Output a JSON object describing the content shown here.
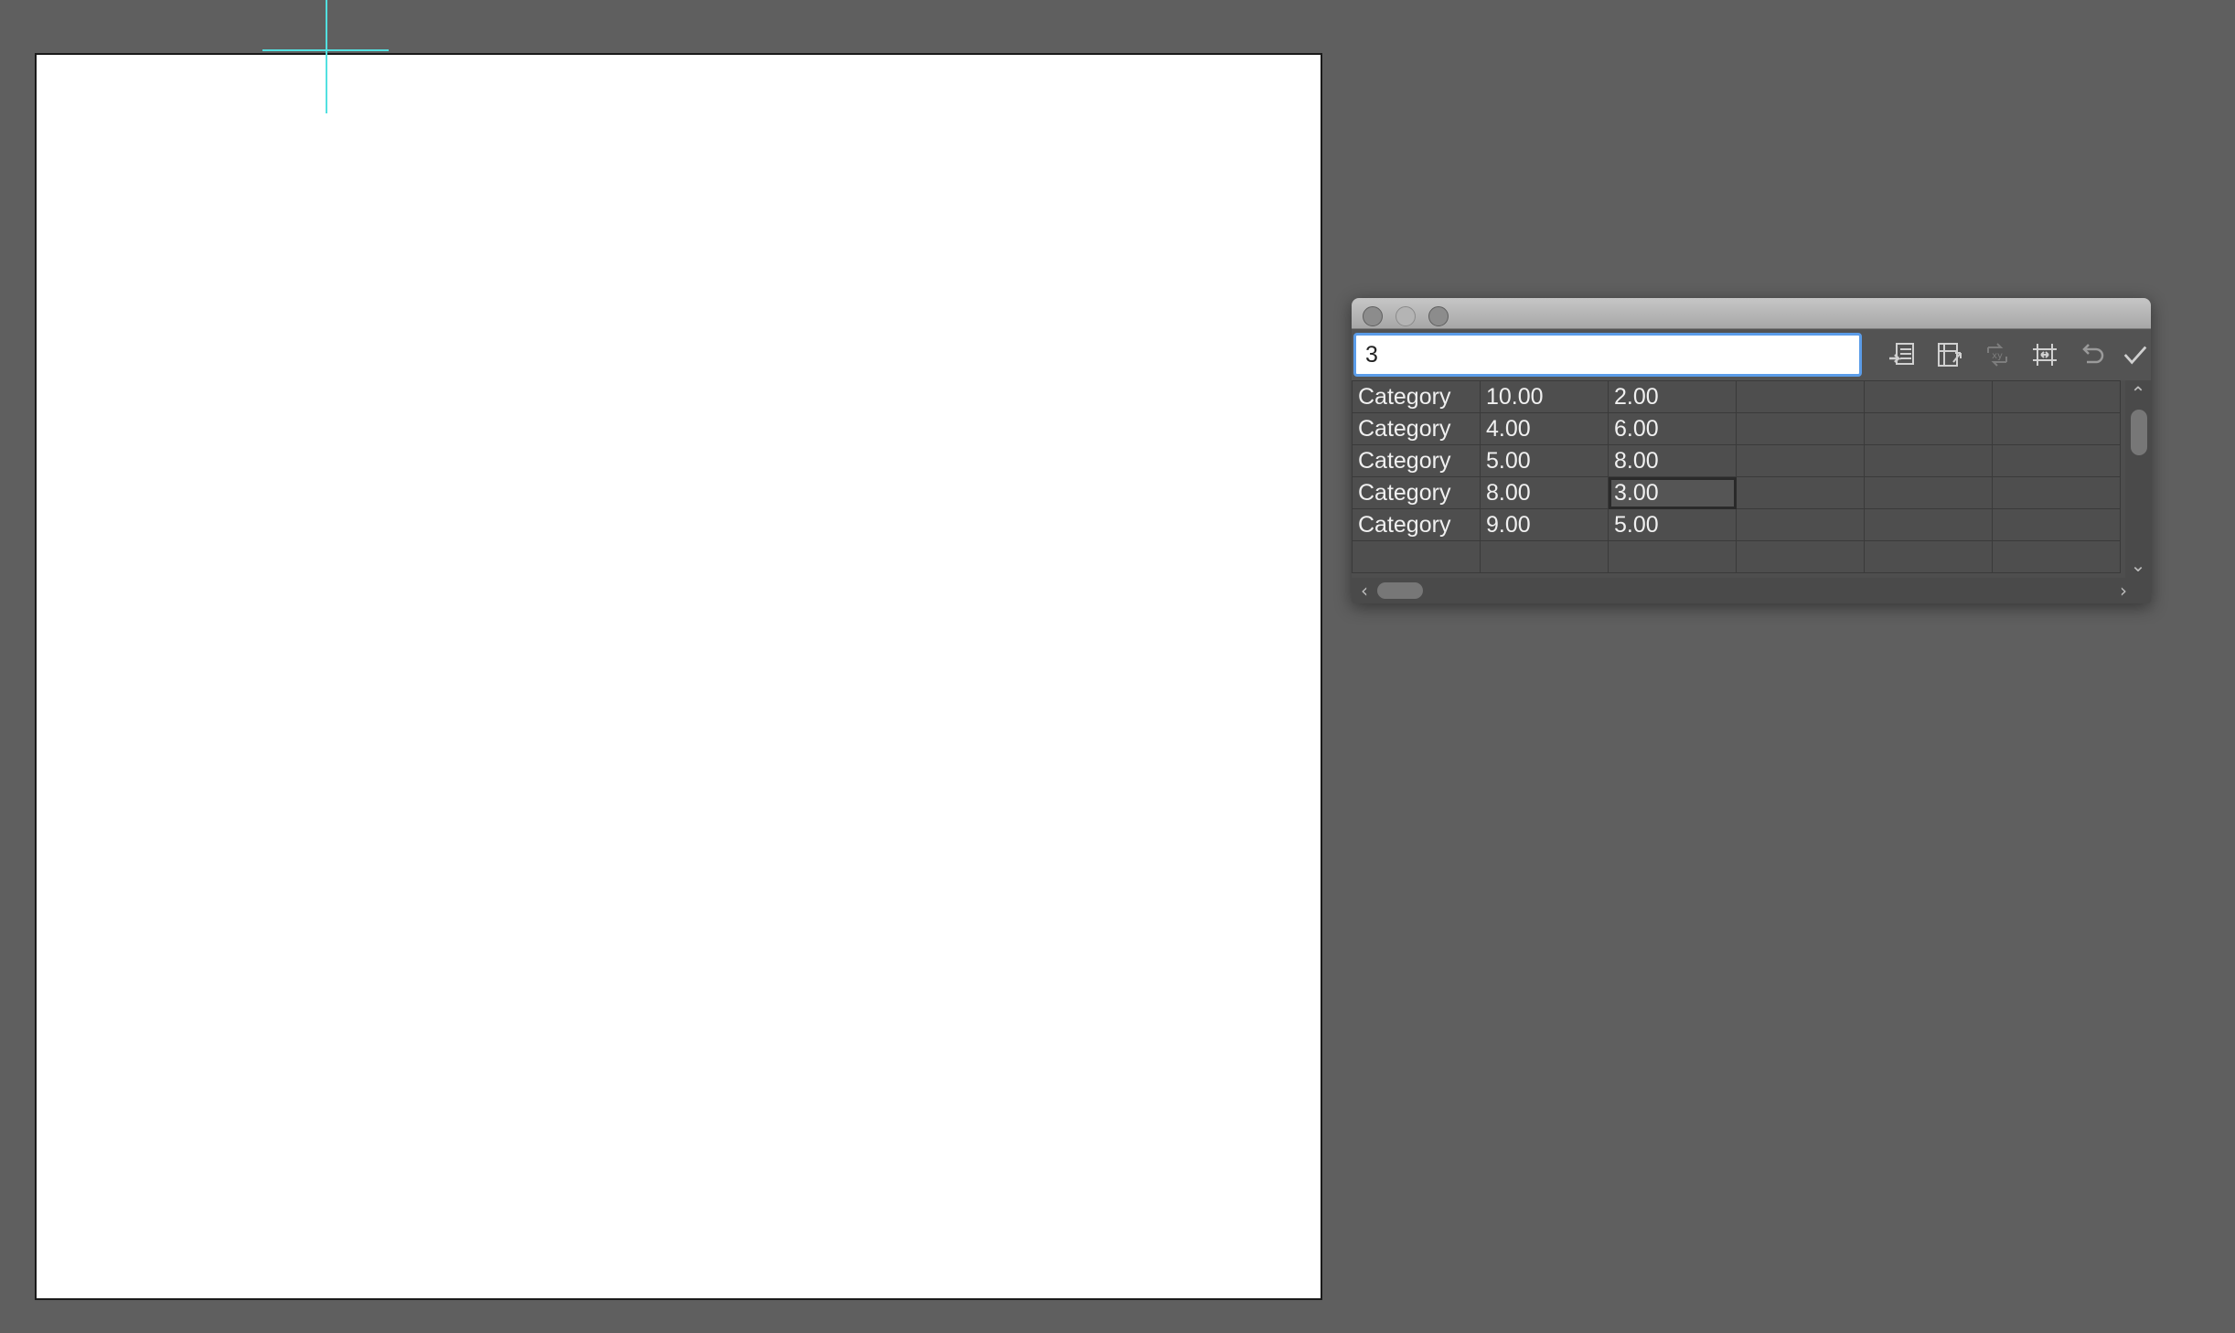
{
  "graph_data_window": {
    "entry_value": "3",
    "toolbar": [
      {
        "name": "import-data-icon",
        "enabled": true
      },
      {
        "name": "transpose-row-column-icon",
        "enabled": true
      },
      {
        "name": "switch-xy-icon",
        "enabled": false
      },
      {
        "name": "cell-style-icon",
        "enabled": true
      },
      {
        "name": "revert-icon",
        "enabled": true
      },
      {
        "name": "apply-check-icon",
        "enabled": true
      }
    ],
    "rows": [
      [
        "Category",
        "10.00",
        "2.00",
        "",
        "",
        ""
      ],
      [
        "Category",
        "4.00",
        "6.00",
        "",
        "",
        ""
      ],
      [
        "Category",
        "5.00",
        "8.00",
        "",
        "",
        ""
      ],
      [
        "Category",
        "8.00",
        "3.00",
        "",
        "",
        ""
      ],
      [
        "Category",
        "9.00",
        "5.00",
        "",
        "",
        ""
      ],
      [
        "",
        "",
        "",
        "",
        "",
        ""
      ]
    ],
    "selected_cell": {
      "row": 3,
      "col": 2
    },
    "colors": {
      "accent": "#5b9ce8",
      "guide": "#52e0e0"
    }
  }
}
